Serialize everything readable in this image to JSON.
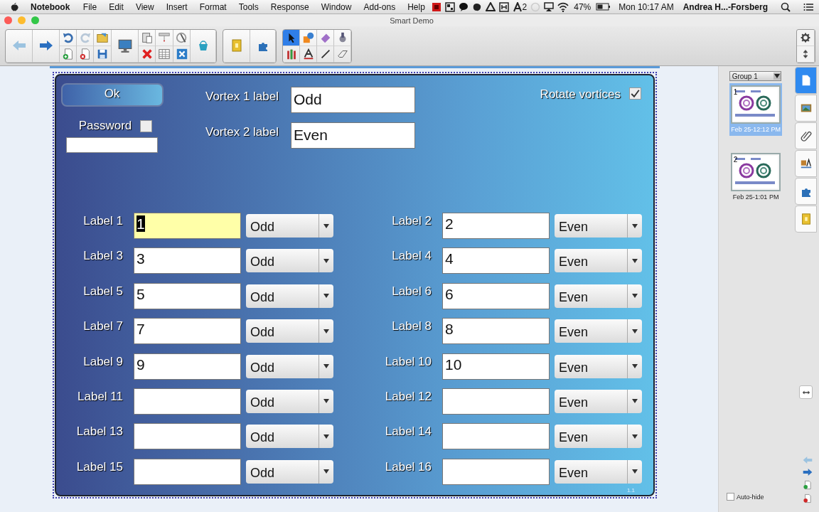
{
  "menubar": {
    "app": "Notebook",
    "menus": [
      "File",
      "Edit",
      "View",
      "Insert",
      "Format",
      "Tools",
      "Response",
      "Window",
      "Add-ons",
      "Help"
    ],
    "badge_count": "2",
    "battery": "47%",
    "clock": "Mon 10:17 AM",
    "user": "Andrea H...-Forsberg"
  },
  "window": {
    "title": "Smart Demo"
  },
  "tools": [
    {
      "kind": "select",
      "selected": true
    },
    {
      "kind": "shapes",
      "selected": false
    },
    {
      "kind": "fill",
      "selected": false
    },
    {
      "kind": "magic",
      "selected": false
    },
    {
      "kind": "pens",
      "selected": false
    },
    {
      "kind": "text",
      "selected": false
    },
    {
      "kind": "line",
      "selected": false
    },
    {
      "kind": "eraser",
      "selected": false
    }
  ],
  "form": {
    "ok_button": "Ok",
    "password": {
      "label": "Password",
      "checked": false
    },
    "vortex_fields": [
      {
        "label": "Vortex 1 label",
        "value": "Odd"
      },
      {
        "label": "Vortex 2 label",
        "value": "Even"
      }
    ],
    "rotate": {
      "label": "Rotate vortices",
      "checked": true
    },
    "rows": [
      {
        "label": "Label 1",
        "value": "1",
        "choice": "Odd",
        "focused": true
      },
      {
        "label": "Label 2",
        "value": "2",
        "choice": "Even",
        "focused": false
      },
      {
        "label": "Label 3",
        "value": "3",
        "choice": "Odd",
        "focused": false
      },
      {
        "label": "Label 4",
        "value": "4",
        "choice": "Even",
        "focused": false
      },
      {
        "label": "Label 5",
        "value": "5",
        "choice": "Odd",
        "focused": false
      },
      {
        "label": "Label 6",
        "value": "6",
        "choice": "Even",
        "focused": false
      },
      {
        "label": "Label 7",
        "value": "7",
        "choice": "Odd",
        "focused": false
      },
      {
        "label": "Label 8",
        "value": "8",
        "choice": "Even",
        "focused": false
      },
      {
        "label": "Label 9",
        "value": "9",
        "choice": "Odd",
        "focused": false
      },
      {
        "label": "Label 10",
        "value": "10",
        "choice": "Even",
        "focused": false
      },
      {
        "label": "Label 11",
        "choice": "Odd",
        "focused": false
      },
      {
        "label": "Label 12",
        "choice": "Even",
        "focused": false
      },
      {
        "label": "Label 13",
        "choice": "Odd",
        "focused": false
      },
      {
        "label": "Label 14",
        "choice": "Even",
        "focused": false
      },
      {
        "label": "Label 15",
        "choice": "Odd",
        "focused": false
      },
      {
        "label": "Label 16",
        "choice": "Even",
        "focused": false
      }
    ],
    "page_number": "1.1"
  },
  "sidebar": {
    "group": "Group 1",
    "pages": [
      {
        "number": "1",
        "date": "Feb 25-12:12 PM",
        "selected": true
      },
      {
        "number": "2",
        "date": "Feb 25-1:01 PM",
        "selected": false
      }
    ],
    "tabs": [
      {
        "kind": "pages",
        "selected": true
      },
      {
        "kind": "gallery",
        "selected": false
      },
      {
        "kind": "attachments",
        "selected": false
      },
      {
        "kind": "properties",
        "selected": false
      },
      {
        "kind": "addons",
        "selected": false
      },
      {
        "kind": "lesson",
        "selected": false
      }
    ],
    "auto_hide": {
      "label": "Auto-hide",
      "checked": false
    }
  }
}
